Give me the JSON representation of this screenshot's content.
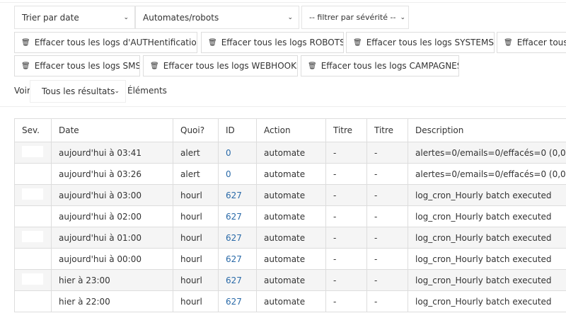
{
  "filters": {
    "sort": "Trier par date",
    "type": "Automates/robots",
    "severity": "-- filtrer par sévérité --"
  },
  "buttons": [
    "Effacer tous les logs d'AUTHentification",
    "Effacer tous les logs ROBOTS",
    "Effacer tous les logs SYSTEMS",
    "Effacer tous les logs",
    "Effacer tous les logs SMS",
    "Effacer tous les logs WEBHOOKS",
    "Effacer tous les logs CAMPAGNES"
  ],
  "length": {
    "before": "Voir",
    "value": "Tous les résultats",
    "after": "Éléments"
  },
  "table": {
    "headers": [
      "Sev.",
      "Date",
      "Quoi?",
      "ID",
      "Action",
      "Titre",
      "Titre",
      "Description"
    ],
    "rows": [
      [
        "aujourd'hui à 03:41",
        "alert",
        "0",
        "automate",
        "-",
        "-",
        "alertes=0/emails=0/effacés=0 (0,0"
      ],
      [
        "aujourd'hui à 03:26",
        "alert",
        "0",
        "automate",
        "-",
        "-",
        "alertes=0/emails=0/effacés=0 (0,0"
      ],
      [
        "aujourd'hui à 03:00",
        "hourl",
        "627",
        "automate",
        "-",
        "-",
        "log_cron_Hourly batch executed"
      ],
      [
        "aujourd'hui à 02:00",
        "hourl",
        "627",
        "automate",
        "-",
        "-",
        "log_cron_Hourly batch executed"
      ],
      [
        "aujourd'hui à 01:00",
        "hourl",
        "627",
        "automate",
        "-",
        "-",
        "log_cron_Hourly batch executed"
      ],
      [
        "aujourd'hui à 00:00",
        "hourl",
        "627",
        "automate",
        "-",
        "-",
        "log_cron_Hourly batch executed"
      ],
      [
        "hier à 23:00",
        "hourl",
        "627",
        "automate",
        "-",
        "-",
        "log_cron_Hourly batch executed"
      ],
      [
        "hier à 22:00",
        "hourl",
        "627",
        "automate",
        "-",
        "-",
        "log_cron_Hourly batch executed"
      ]
    ]
  }
}
